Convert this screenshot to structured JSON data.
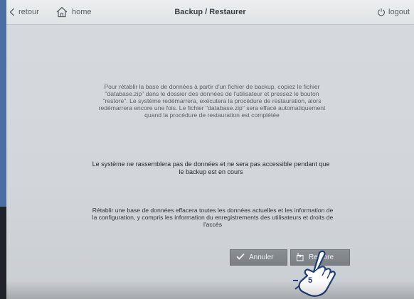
{
  "topbar": {
    "back_label": "retour",
    "home_label": "home",
    "title": "Backup / Restaurer",
    "logout_label": "logout"
  },
  "messages": {
    "restore_info": "Pour rétablir la base de données à partir d'un fichier de backup, copiez le fichier \"database.zip\" dans le dossier des données de l'utilisateur et pressez le bouton \"restore\". Le système redémarrera, exécutera la procédure de restauration, alors redémarrera encore une fois. Le fichier \"database.zip\" sera effacé automatiquement quand la procédure de restauration est complétée",
    "backup_warning": "Le système ne rassemblera pas de données et ne sera pas accessible pendant que le backup est en cours",
    "restore_warning": "Rétablir une base de données effacera toutes les données actuelles et les information de la configuration, y compris les information du enregistrements des utilisateurs et droits de l'accès"
  },
  "actions": {
    "cancel_label": "Annuler",
    "restore_label": "Restore"
  },
  "annotation": {
    "step_number": "5"
  },
  "icons": {
    "back": "chevron-left-icon",
    "home": "home-icon",
    "logout": "power-icon",
    "cancel": "checkmark-icon",
    "restore": "restore-icon",
    "pointer": "hand-pointer-icon"
  },
  "colors": {
    "accent": "#4a6fa5",
    "topbar": "#e6e8ea",
    "background": "#d4d8dc",
    "button": "#83888d",
    "button_text": "#f2f3f4",
    "callout_outline": "#1e3e7a"
  }
}
